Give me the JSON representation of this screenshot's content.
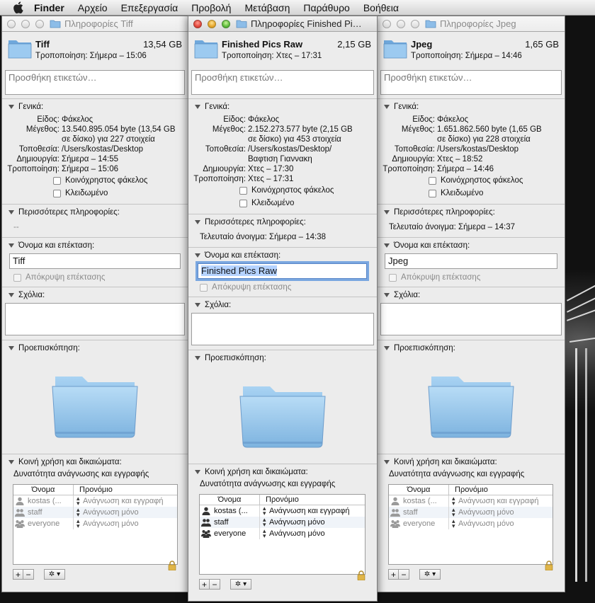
{
  "menubar": {
    "items": [
      "Finder",
      "Αρχείο",
      "Επεξεργασία",
      "Προβολή",
      "Μετάβαση",
      "Παράθυρο",
      "Βοήθεια"
    ]
  },
  "labels": {
    "tags_placeholder": "Προσθήκη ετικετών…",
    "general": "Γενικά:",
    "kind": "Είδος:",
    "size": "Μέγεθος:",
    "where": "Τοποθεσία:",
    "created": "Δημιουργία:",
    "modified": "Τροποποίηση:",
    "shared_folder": "Κοινόχρηστος φάκελος",
    "locked": "Κλειδωμένο",
    "more_info": "Περισσότερες πληροφορίες:",
    "name_ext": "Όνομα και επέκταση:",
    "hide_ext": "Απόκρυψη επέκτασης",
    "comments": "Σχόλια:",
    "preview": "Προεπισκόπηση:",
    "sharing": "Κοινή χρήση και δικαιώματα:",
    "perm_summary": "Δυνατότητα ανάγνωσης και εγγραφής",
    "col_name": "Όνομα",
    "col_priv": "Προνόμιο",
    "add": "+",
    "remove": "−",
    "gear": "✲ ▾"
  },
  "windows": [
    {
      "title": "Πληροφορίες Tiff",
      "name": "Tiff",
      "size_short": "13,54 GB",
      "modified_line": "Τροποποίηση: Σήμερα – 15:06",
      "kind": "Φάκελος",
      "size_line1": "13.540.895.054 byte (13,54 GB",
      "size_line2": "σε δίσκο) για 227 στοιχεία",
      "where_line1": "/Users/kostas/Desktop",
      "where_line2": "",
      "created": "Σήμερα – 14:55",
      "modified": "Σήμερα – 15:06",
      "more_info": "--",
      "name_field": "Tiff",
      "perms": [
        {
          "user": "kostas (...",
          "priv": "Ανάγνωση και εγγραφή"
        },
        {
          "user": "staff",
          "priv": "Ανάγνωση μόνο"
        },
        {
          "user": "everyone",
          "priv": "Ανάγνωση μόνο"
        }
      ]
    },
    {
      "title": "Πληροφορίες Finished Pi…",
      "name": "Finished Pics Raw",
      "size_short": "2,15 GB",
      "modified_line": "Τροποποίηση: Χτες – 17:31",
      "kind": "Φάκελος",
      "size_line1": "2.152.273.577 byte (2,15 GB",
      "size_line2": "σε δίσκο) για 453 στοιχεία",
      "where_line1": "/Users/kostas/Desktop/",
      "where_line2": "Βαφτιση Γιαννακη",
      "created": "Χτες – 17:30",
      "modified": "Χτες – 17:31",
      "more_info": "Τελευταίο άνοιγμα: Σήμερα – 14:38",
      "name_field": "Finished Pics Raw",
      "perms": [
        {
          "user": "kostas (...",
          "priv": "Ανάγνωση και εγγραφή"
        },
        {
          "user": "staff",
          "priv": "Ανάγνωση μόνο"
        },
        {
          "user": "everyone",
          "priv": "Ανάγνωση μόνο"
        }
      ]
    },
    {
      "title": "Πληροφορίες Jpeg",
      "name": "Jpeg",
      "size_short": "1,65 GB",
      "modified_line": "Τροποποίηση: Σήμερα – 14:46",
      "kind": "Φάκελος",
      "size_line1": "1.651.862.560 byte (1,65 GB",
      "size_line2": "σε δίσκο) για 228 στοιχεία",
      "where_line1": "/Users/kostas/Desktop",
      "where_line2": "",
      "created": "Χτες – 18:52",
      "modified": "Σήμερα – 14:46",
      "more_info": "Τελευταίο άνοιγμα: Σήμερα – 14:37",
      "name_field": "Jpeg",
      "perms": [
        {
          "user": "kostas (...",
          "priv": "Ανάγνωση και εγγραφή"
        },
        {
          "user": "staff",
          "priv": "Ανάγνωση μόνο"
        },
        {
          "user": "everyone",
          "priv": "Ανάγνωση μόνο"
        }
      ]
    }
  ]
}
